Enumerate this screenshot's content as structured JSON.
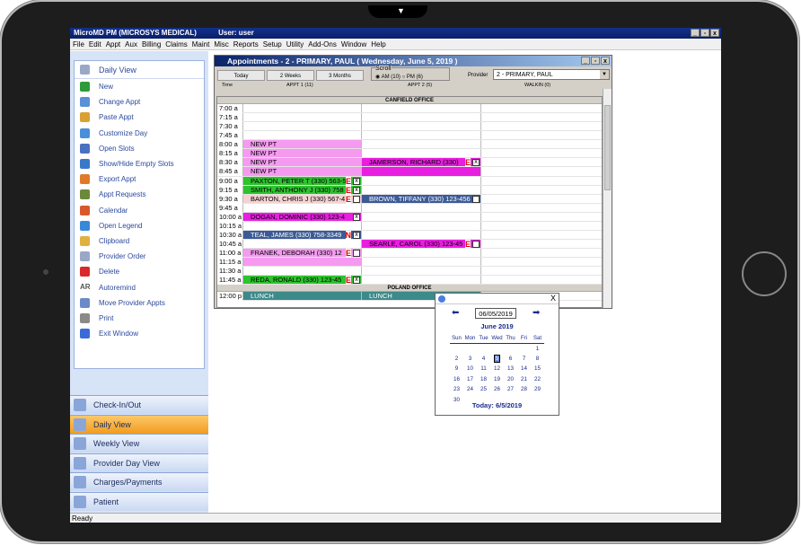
{
  "app": {
    "title": "MicroMD PM (MICROSYS MEDICAL)",
    "user": "User: user",
    "win_buttons": [
      "_",
      "̅",
      "X"
    ]
  },
  "menu": [
    "File",
    "Edit",
    "Appt",
    "Aux",
    "Billing",
    "Claims",
    "Maint",
    "Misc",
    "Reports",
    "Setup",
    "Utility",
    "Add-Ons",
    "Window",
    "Help"
  ],
  "tasks": {
    "header": "Daily View",
    "items": [
      {
        "label": "New",
        "icon": "add-icon",
        "color": "#2e9a3a"
      },
      {
        "label": "Change Appt",
        "icon": "edit-appt-icon",
        "color": "#5b8fd6"
      },
      {
        "label": "Paste Appt",
        "icon": "paste-icon",
        "color": "#d9a035"
      },
      {
        "label": "Customize Day",
        "icon": "customize-icon",
        "color": "#4a8fd9"
      },
      {
        "label": "Open Slots",
        "icon": "slots-icon",
        "color": "#4a70c0"
      },
      {
        "label": "Show/Hide Empty Slots",
        "icon": "toggle-slots-icon",
        "color": "#3a78c8"
      },
      {
        "label": "Export Appt",
        "icon": "export-icon",
        "color": "#e07a2a"
      },
      {
        "label": "Appt Requests",
        "icon": "requests-icon",
        "color": "#6a8a3a"
      },
      {
        "label": "Calendar",
        "icon": "calendar-icon",
        "color": "#d8582a"
      },
      {
        "label": "Open Legend",
        "icon": "legend-icon",
        "color": "#3a88d8"
      },
      {
        "label": "Clipboard",
        "icon": "clipboard-icon",
        "color": "#e0b040"
      },
      {
        "label": "Provider Order",
        "icon": "order-icon",
        "color": "#9aa8c8"
      },
      {
        "label": "Delete",
        "icon": "delete-icon",
        "color": "#d82a2a"
      },
      {
        "label": "Autoremind",
        "icon": "autoremind-icon",
        "color": "#555555",
        "glyph": "AR"
      },
      {
        "label": "Move Provider Appts",
        "icon": "move-icon",
        "color": "#6a8ac8"
      },
      {
        "label": "Print",
        "icon": "print-icon",
        "color": "#8a8a8a"
      },
      {
        "label": "Exit Window",
        "icon": "exit-icon",
        "color": "#3a6ad8"
      }
    ]
  },
  "nav_buttons": [
    {
      "label": "Check-In/Out",
      "icon": "checkin-icon",
      "active": false
    },
    {
      "label": "Daily View",
      "icon": "daily-view-icon",
      "active": true
    },
    {
      "label": "Weekly View",
      "icon": "weekly-view-icon",
      "active": false
    },
    {
      "label": "Provider Day View",
      "icon": "provider-day-icon",
      "active": false
    },
    {
      "label": "Charges/Payments",
      "icon": "charges-icon",
      "active": false
    },
    {
      "label": "Patient",
      "icon": "patient-icon",
      "active": false
    }
  ],
  "status": "Ready",
  "appointments": {
    "title": "Appointments - 2 - PRIMARY, PAUL  ( Wednesday, June 5, 2019 )",
    "nav": [
      "Today",
      "2 Weeks",
      "3 Months"
    ],
    "scroll_label": "Scroll",
    "scroll_am": "AM (10)",
    "scroll_pm": "PM (6)",
    "provider_label": "Provider",
    "provider_value": "2 - PRIMARY, PAUL",
    "col_time": "Time",
    "col1": "APPT 1 (11)",
    "col2": "APPT 2 (5)",
    "col3": "WALKIN (0)",
    "office1": "CANFIELD OFFICE",
    "office2": "POLAND OFFICE",
    "rows": [
      {
        "t": "7:00 a"
      },
      {
        "t": "7:15 a"
      },
      {
        "t": "7:30 a"
      },
      {
        "t": "7:45 a"
      },
      {
        "t": "8:00 a",
        "c1": {
          "text": "NEW  PT",
          "bg": "#f59af0"
        }
      },
      {
        "t": "8:15 a",
        "c1": {
          "text": "NEW  PT",
          "bg": "#f59af0"
        }
      },
      {
        "t": "8:30 a",
        "c1": {
          "text": "NEW  PT",
          "bg": "#f59af0"
        },
        "c2": {
          "text": "JAMERSON, RICHARD   (330)",
          "bg": "#e81ee0",
          "mark": "E",
          "box": "x"
        }
      },
      {
        "t": "8:45 a",
        "c1": {
          "text": "NEW  PT",
          "bg": "#f59af0"
        },
        "c2": {
          "text": "",
          "bg": "#e81ee0"
        }
      },
      {
        "t": "9:00 a",
        "c1": {
          "text": "PAXTON, PETER T  (330) 563-5",
          "bg": "#2ec22e",
          "mark": "E",
          "box": "x"
        }
      },
      {
        "t": "9:15 a",
        "c1": {
          "text": "SMITH, ANTHONY J  (330) 758",
          "bg": "#2ec22e",
          "mark": "E",
          "box": "x"
        }
      },
      {
        "t": "9:30 a",
        "c1": {
          "text": "BARTON, CHRIS J  (330) 567-4",
          "bg": "#f5d2d2",
          "mark": "E",
          "box": ""
        },
        "c2": {
          "text": "BROWN, TIFFANY   (330) 123-456",
          "bg": "#3c5a96",
          "fg": "#fff",
          "box": ""
        }
      },
      {
        "t": "9:45 a"
      },
      {
        "t": "10:00 a",
        "c1": {
          "text": "DOGAN, DOMINIC   (330) 123-4",
          "bg": "#e81ee0",
          "box": "x"
        }
      },
      {
        "t": "10:15 a"
      },
      {
        "t": "10:30 a",
        "c1": {
          "text": "TEAL, JAMES  (330) 758-3349",
          "bg": "#3c5a96",
          "fg": "#fff",
          "mark": "N",
          "box": "x"
        }
      },
      {
        "t": "10:45 a",
        "c2": {
          "text": "SEARLE, CAROL   (330) 123-45",
          "bg": "#e81ee0",
          "mark": "E",
          "box": ""
        }
      },
      {
        "t": "11:00 a",
        "c1": {
          "text": "FRANEK, DEBORAH  (330) 12",
          "bg": "#f59af0",
          "mark": "E",
          "box": ""
        }
      },
      {
        "t": "11:15 a",
        "c1": {
          "text": "",
          "bg": "#f59af0"
        }
      },
      {
        "t": "11:30 a"
      },
      {
        "t": "11:45 a",
        "c1": {
          "text": "REDA, RONALD  (330) 123-45",
          "bg": "#2ec22e",
          "mark": "E",
          "box": "x"
        }
      },
      {
        "office": "POLAND OFFICE"
      },
      {
        "t": "12:00 p",
        "c1": {
          "text": "LUNCH",
          "bg": "#3c8a8a",
          "fg": "#fff"
        },
        "c2": {
          "text": "LUNCH",
          "bg": "#3c8a8a",
          "fg": "#fff"
        }
      }
    ]
  },
  "calendar": {
    "date": "06/05/2019",
    "month": "June 2019",
    "days": [
      "Sun",
      "Mon",
      "Tue",
      "Wed",
      "Thu",
      "Fri",
      "Sat"
    ],
    "weeks": [
      [
        "",
        "",
        "",
        "",
        "",
        "",
        "1"
      ],
      [
        "2",
        "3",
        "4",
        "5",
        "6",
        "7",
        "8"
      ],
      [
        "9",
        "10",
        "11",
        "12",
        "13",
        "14",
        "15"
      ],
      [
        "16",
        "17",
        "18",
        "19",
        "20",
        "21",
        "22"
      ],
      [
        "23",
        "24",
        "25",
        "26",
        "27",
        "28",
        "29"
      ],
      [
        "30",
        "",
        "",
        "",
        "",
        "",
        ""
      ]
    ],
    "selected": "5",
    "today": "Today: 6/5/2019",
    "close": "X"
  }
}
